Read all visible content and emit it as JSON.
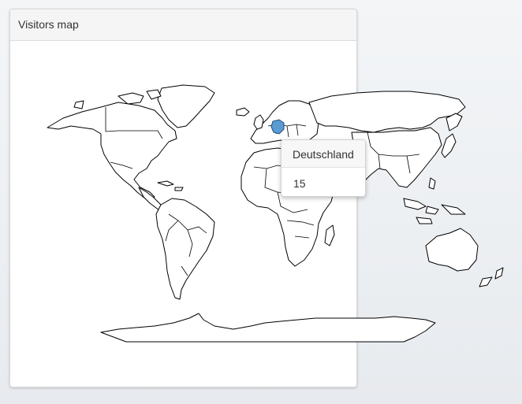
{
  "panel": {
    "title": "Visitors map"
  },
  "tooltip": {
    "country": "Deutschland",
    "value": "15"
  },
  "map": {
    "highlight_color": "#5b9bd1",
    "highlighted_country": "Deutschland"
  }
}
